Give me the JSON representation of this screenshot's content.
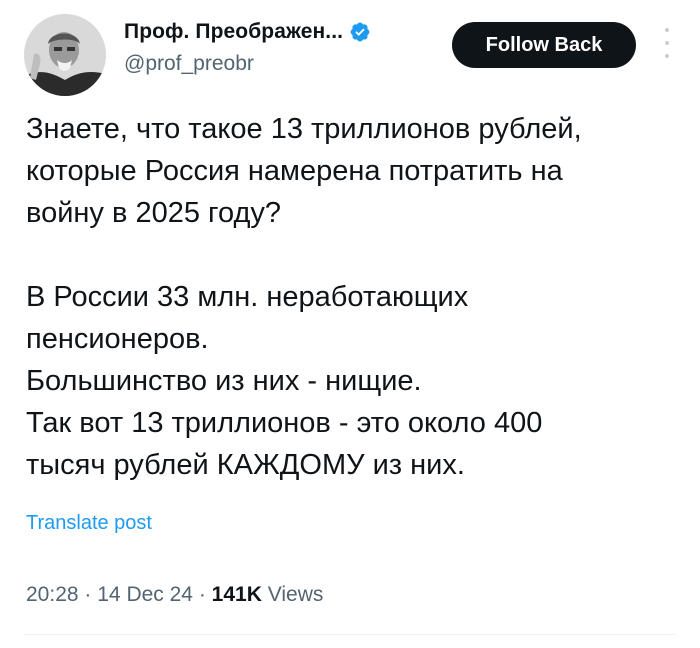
{
  "author": {
    "display_name": "Проф. Преображен...",
    "handle": "@prof_preobr",
    "verified": true
  },
  "follow_button": {
    "label": "Follow Back"
  },
  "post": {
    "text": "Знаете, что такое 13 триллионов рублей,\nкоторые Россия намерена потратить на\nвойну в 2025 году?\n\nВ России 33 млн. неработающих\nпенсионеров.\nБольшинство из них - нищие.\nТак вот 13 триллионов - это около 400\nтысяч рублей КАЖДОМУ из них.",
    "translate_label": "Translate post"
  },
  "meta": {
    "time": "20:28",
    "separator": "·",
    "date": "14 Dec 24",
    "views_count": "141K",
    "views_label": "Views"
  },
  "icons": {
    "verified": "verified-badge-icon",
    "more": "more-options-icon"
  },
  "colors": {
    "text": "#0f1419",
    "secondary": "#536471",
    "link": "#1d9bf0",
    "verified": "#1d9bf0",
    "button_bg": "#0f1419"
  }
}
